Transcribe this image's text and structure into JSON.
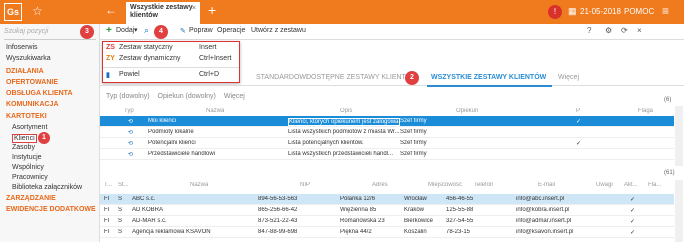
{
  "app": {
    "logo": "Gs",
    "tab_title": "Wszystkie zestawy klientów",
    "date": "21-05-2018",
    "help": "POMOC"
  },
  "sidebar": {
    "search_placeholder": "Szukaj pozycji",
    "items": [
      "Infoserwis",
      "Wyszukiwarka"
    ],
    "sections": [
      "DZIAŁANIA",
      "OFERTOWANIE",
      "OBSŁUGA KLIENTA",
      "KOMUNIKACJA",
      "KARTOTEKI",
      "ZARZĄDZANIE",
      "EWIDENCJE DODATKOWE"
    ],
    "kartoteki": [
      "Asortyment",
      "Klienci",
      "Zasoby",
      "Instytucje",
      "Wspólnicy",
      "Pracownicy",
      "Biblioteka załączników"
    ]
  },
  "toolbar": {
    "add": "Dodaj",
    "edit": "Popraw",
    "ops": "Operacje",
    "create": "Utwórz z zestawu"
  },
  "dropdown": [
    {
      "icon": "ZS",
      "label": "Zestaw statyczny",
      "key": "Insert"
    },
    {
      "icon": "ZY",
      "label": "Zestaw dynamiczny",
      "key": "Ctrl+Insert"
    },
    {
      "icon": "▮",
      "label": "Powiel",
      "key": "Ctrl+D"
    }
  ],
  "tabs": {
    "standard": "STANDARDOWI",
    "available": "DOSTĘPNE ZESTAWY KLIENTÓW",
    "all": "WSZYSTKIE ZESTAWY KLIENTÓW",
    "more": "Więcej"
  },
  "filters": {
    "type": "Typ (dowolny)",
    "caretaker": "Opiekun (dowolny)",
    "more": "Więcej"
  },
  "grid1": {
    "count": "(6)",
    "headers": [
      "Typ",
      "Nazwa",
      "Opis",
      "Opiekun",
      "P",
      "Flaga"
    ],
    "rows": [
      {
        "name": "Moi klienci",
        "desc": "Klienci, których opiekunem jest zalogowa...",
        "owner": "Szef firmy",
        "p": "✓"
      },
      {
        "name": "Podmioty lokalne",
        "desc": "Lista wszystkich podmiotów z miasta Wr...",
        "owner": "Szef firmy",
        "p": ""
      },
      {
        "name": "Potencjalni klienci",
        "desc": "Lista potencjalnych klientów.",
        "owner": "Szef firmy",
        "p": "✓"
      },
      {
        "name": "Przedstawiciele handlowi",
        "desc": "Lista wszystkich przedstawicieli handl...",
        "owner": "Szef firmy",
        "p": ""
      }
    ]
  },
  "grid2": {
    "count": "(61)",
    "headers": [
      "T...",
      "St...",
      "Nazwa",
      "NIP",
      "Adres",
      "Miejscowość",
      "Telefon",
      "E-mail",
      "Uwagi",
      "Akt...",
      "Fla..."
    ],
    "rows": [
      {
        "t": "FI",
        "s": "S",
        "name": "ABC s.c.",
        "nip": "894-56-53-563",
        "addr": "Polanka 12/6",
        "city": "Wrocław",
        "phone": "456-46-55",
        "email": "info@abc.insert.pl",
        "akt": "✓"
      },
      {
        "t": "FI",
        "s": "S",
        "name": "AD KOBRA",
        "nip": "865-256-66-42",
        "addr": "Więzienna 85",
        "city": "Kraków",
        "phone": "125-55-88",
        "email": "info@kobra.insert.pl",
        "akt": "✓"
      },
      {
        "t": "FI",
        "s": "S",
        "name": "AD-MAR s.c.",
        "nip": "873-521-22-43",
        "addr": "Romanowska 23",
        "city": "Bierkowice",
        "phone": "327-54-55",
        "email": "info@admar.insert.pl",
        "akt": "✓"
      },
      {
        "t": "FI",
        "s": "S",
        "name": "Agencja reklamowa KSAVON",
        "nip": "847-88-99-698",
        "addr": "Piękna 44/2",
        "city": "Koszalin",
        "phone": "78-23-15",
        "email": "info@ksavon.insert.pl",
        "akt": "✓"
      }
    ]
  },
  "callouts": [
    "1",
    "2",
    "3",
    "4"
  ],
  "colors": {
    "accent": "#f07a1e",
    "selection": "#1a8cd8",
    "callout": "#e04040"
  }
}
